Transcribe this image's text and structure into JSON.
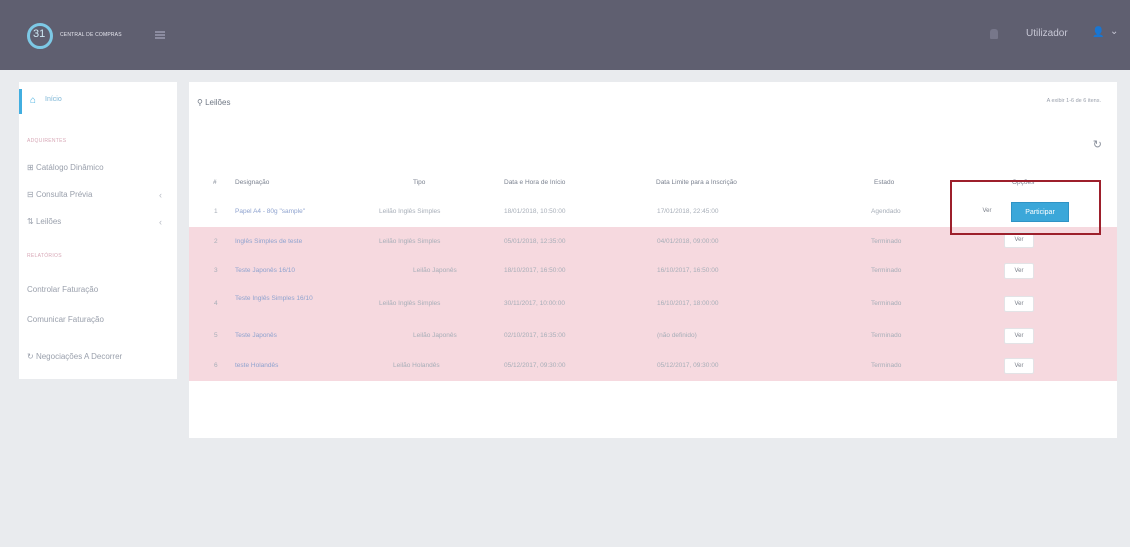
{
  "header": {
    "logo_number": "31",
    "logo_text": "CENTRAL DE COMPRAS",
    "user_name": "Utilizador"
  },
  "sidebar": {
    "home_label": "Início",
    "section1": "ADQUIRENTES",
    "items": [
      {
        "label": "Catálogo Dinâmico"
      },
      {
        "label": "Consulta Prévia"
      },
      {
        "label": "Leilões"
      }
    ],
    "section2": "RELATÓRIOS",
    "items2": [
      {
        "label": "Controlar Faturação"
      },
      {
        "label": "Comunicar Faturação"
      },
      {
        "label": "Negociações A Decorrer"
      }
    ]
  },
  "main": {
    "title": "Leilões",
    "count_text": "A exibir 1-6 de 6 itens.",
    "columns": [
      "#",
      "Designação",
      "Tipo",
      "Data e Hora de Início",
      "Data Limite para a Inscrição",
      "Estado",
      "Opções"
    ],
    "rows": [
      {
        "n": "1",
        "designacao": "Papel A4 - 80g \"sample\"",
        "tipo": "Leilão Inglês Simples",
        "inicio": "18/01/2018, 10:50:00",
        "limite": "17/01/2018, 22:45:00",
        "estado": "Agendado",
        "ver": "Ver",
        "participar": "Participar"
      },
      {
        "n": "2",
        "designacao": "Inglês Simples de teste",
        "tipo": "Leilão Inglês Simples",
        "inicio": "05/01/2018, 12:35:00",
        "limite": "04/01/2018, 09:00:00",
        "estado": "Terminado",
        "ver": "Ver"
      },
      {
        "n": "3",
        "designacao": "Teste Japonês 16/10",
        "tipo": "Leilão Japonês",
        "inicio": "18/10/2017, 16:50:00",
        "limite": "16/10/2017, 16:50:00",
        "estado": "Terminado",
        "ver": "Ver"
      },
      {
        "n": "4",
        "designacao": "Teste Inglês Simples 16/10",
        "tipo": "Leilão Inglês Simples",
        "inicio": "30/11/2017, 10:00:00",
        "limite": "16/10/2017, 18:00:00",
        "estado": "Terminado",
        "ver": "Ver"
      },
      {
        "n": "5",
        "designacao": "Teste Japonês",
        "tipo": "Leilão Japonês",
        "inicio": "02/10/2017, 16:35:00",
        "limite": "(não definido)",
        "estado": "Terminado",
        "ver": "Ver"
      },
      {
        "n": "6",
        "designacao": "teste Holandês",
        "tipo": "Leilão Holandês",
        "inicio": "05/12/2017, 09:30:00",
        "limite": "05/12/2017, 09:30:00",
        "estado": "Terminado",
        "ver": "Ver"
      }
    ]
  }
}
